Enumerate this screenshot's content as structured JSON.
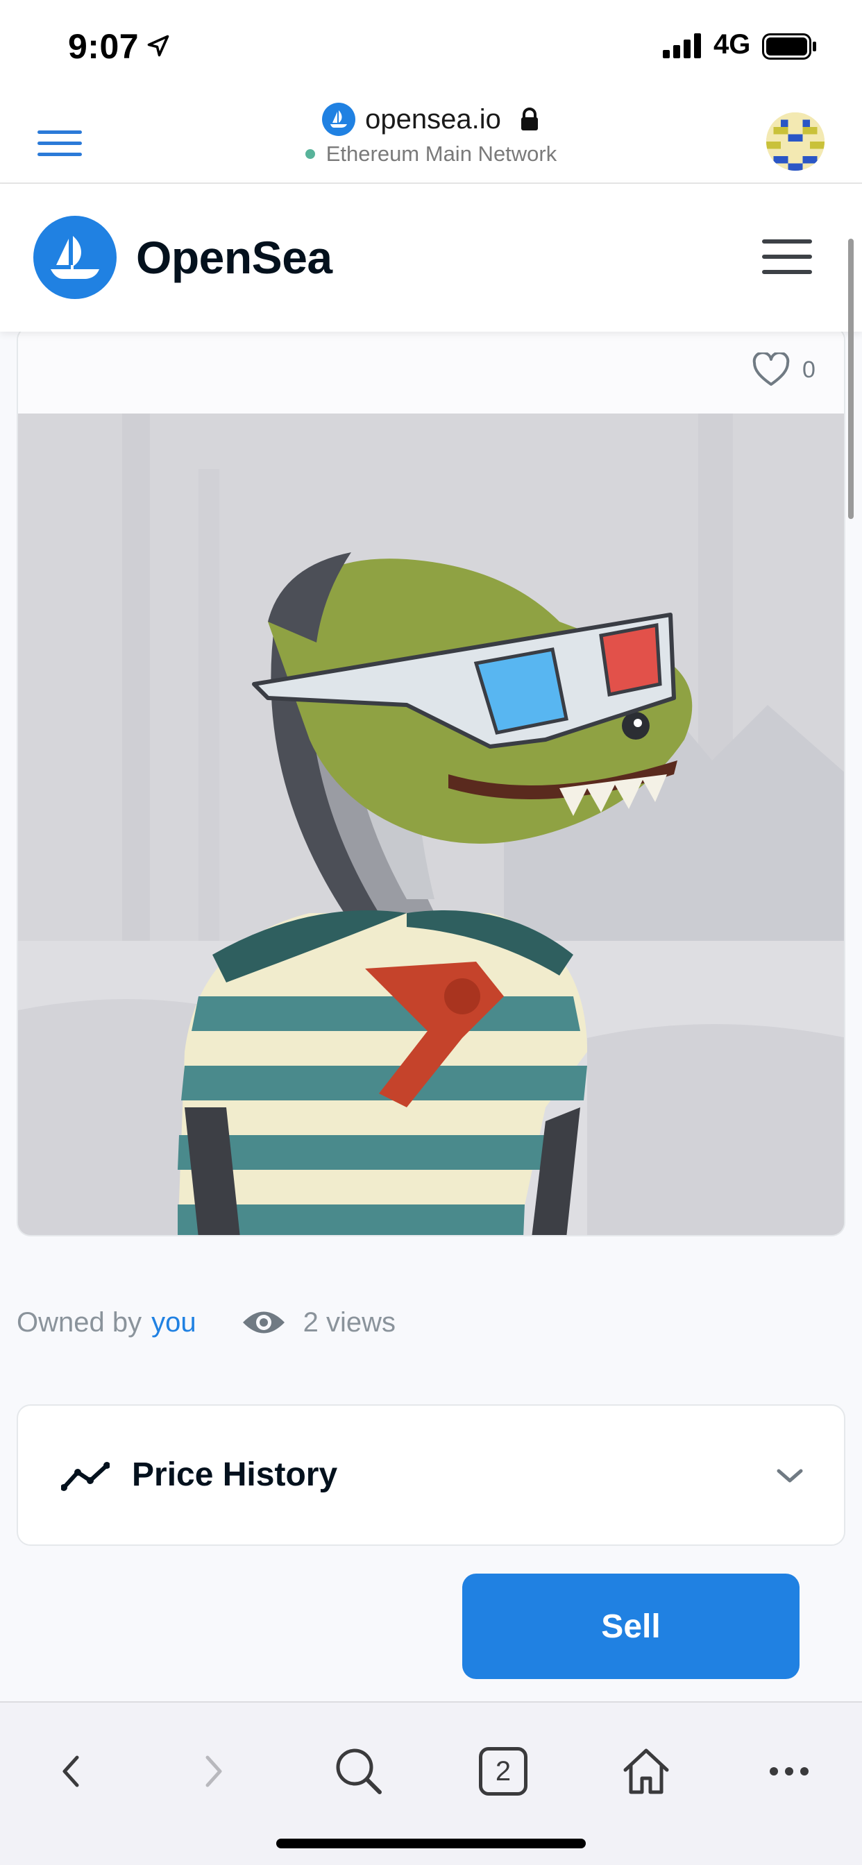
{
  "status_bar": {
    "time": "9:07",
    "network": "4G"
  },
  "browser": {
    "domain": "opensea.io",
    "network_label": "Ethereum Main Network"
  },
  "site": {
    "brand": "OpenSea"
  },
  "item": {
    "favorites_count": "0",
    "owner_prefix": "Owned by",
    "owner_link": "you",
    "views": "2 views"
  },
  "price_history": {
    "title": "Price History"
  },
  "actions": {
    "sell_label": "Sell"
  },
  "toolbar": {
    "tabs_count": "2"
  },
  "colors": {
    "accent": "#2081e2",
    "text_dark": "#04111d",
    "muted": "#8a939b"
  },
  "icons": {
    "browser_menu": "hamburger-icon",
    "favicon": "opensea-icon",
    "lock": "lock-icon",
    "favorite": "heart-icon",
    "views": "eye-icon",
    "price_history": "trend-line-icon",
    "expand": "chevron-down-icon",
    "back": "chevron-left-icon",
    "forward": "chevron-right-icon",
    "search": "search-icon",
    "home": "home-icon",
    "more": "more-icon"
  }
}
